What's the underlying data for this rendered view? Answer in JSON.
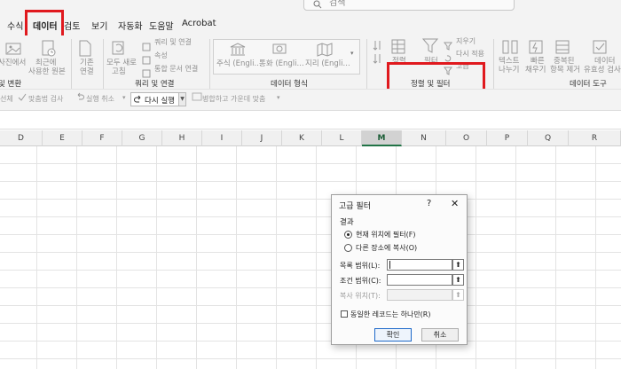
{
  "search": {
    "placeholder": "검색"
  },
  "tabs": [
    {
      "id": "formulas",
      "label": "수식"
    },
    {
      "id": "data",
      "label": "데이터",
      "active": true
    },
    {
      "id": "review",
      "label": "검토"
    },
    {
      "id": "view",
      "label": "보기"
    },
    {
      "id": "automate",
      "label": "자동화"
    },
    {
      "id": "help",
      "label": "도움말"
    },
    {
      "id": "acrobat",
      "label": "Acrobat"
    }
  ],
  "ribbon": {
    "from_picture": "사진에서",
    "recent_sources": [
      "최근에",
      "사용한 원본"
    ],
    "existing": [
      "기존",
      "연결"
    ],
    "refresh_all": [
      "모두 새로",
      "고침"
    ],
    "queries_connections": "쿼리 및 연결",
    "properties": "속성",
    "edit_links": "통합 문서 연결",
    "stocks": "주식 (Engli...",
    "currency": "통화 (Engli...",
    "geography": "지리 (Engli...",
    "sort": "정렬",
    "filter": "필터",
    "clear": "지우기",
    "reapply": "다시 적용",
    "advanced": "고급",
    "text_to_columns": [
      "텍스트",
      "나누기"
    ],
    "flash_fill": [
      "빠른",
      "채우기"
    ],
    "remove_duplicates": [
      "중복된",
      "항목 제거"
    ],
    "data_validation": [
      "데이터",
      "유효성 검사"
    ],
    "groups": {
      "transform": "및 변환",
      "queries": "쿼리 및 연결",
      "data_types": "데이터 형식",
      "sort_filter": "정렬 및 필터",
      "data_tools": "데이터 도구"
    }
  },
  "quickbar": {
    "spell_partial": "선체",
    "spell_check": "맞춤법 검사",
    "undo": "실행 취소",
    "rerun": "다시 실행",
    "merge_center": "병합하고 가운데 맞춤"
  },
  "columns": [
    "D",
    "E",
    "F",
    "G",
    "H",
    "I",
    "J",
    "K",
    "L",
    "M",
    "N",
    "O",
    "P",
    "Q",
    "R"
  ],
  "selected_column": "M",
  "dialog": {
    "title": "고급 필터",
    "help": "?",
    "close": "✕",
    "result_label": "결과",
    "option_in_place": "현재 위치에 필터(F)",
    "option_copy": "다른 장소에 복사(O)",
    "list_range_label": "목록 범위(L):",
    "criteria_range_label": "조건 범위(C):",
    "copy_to_label": "복사 위치(T):",
    "unique_only": "동일한 레코드는 하나만(R)",
    "ok": "확인",
    "cancel": "취소",
    "range_picker": "⬆"
  },
  "colors": {
    "accent": "#217346",
    "highlight": "#e0191e",
    "primary_button": "#1e69c9"
  }
}
